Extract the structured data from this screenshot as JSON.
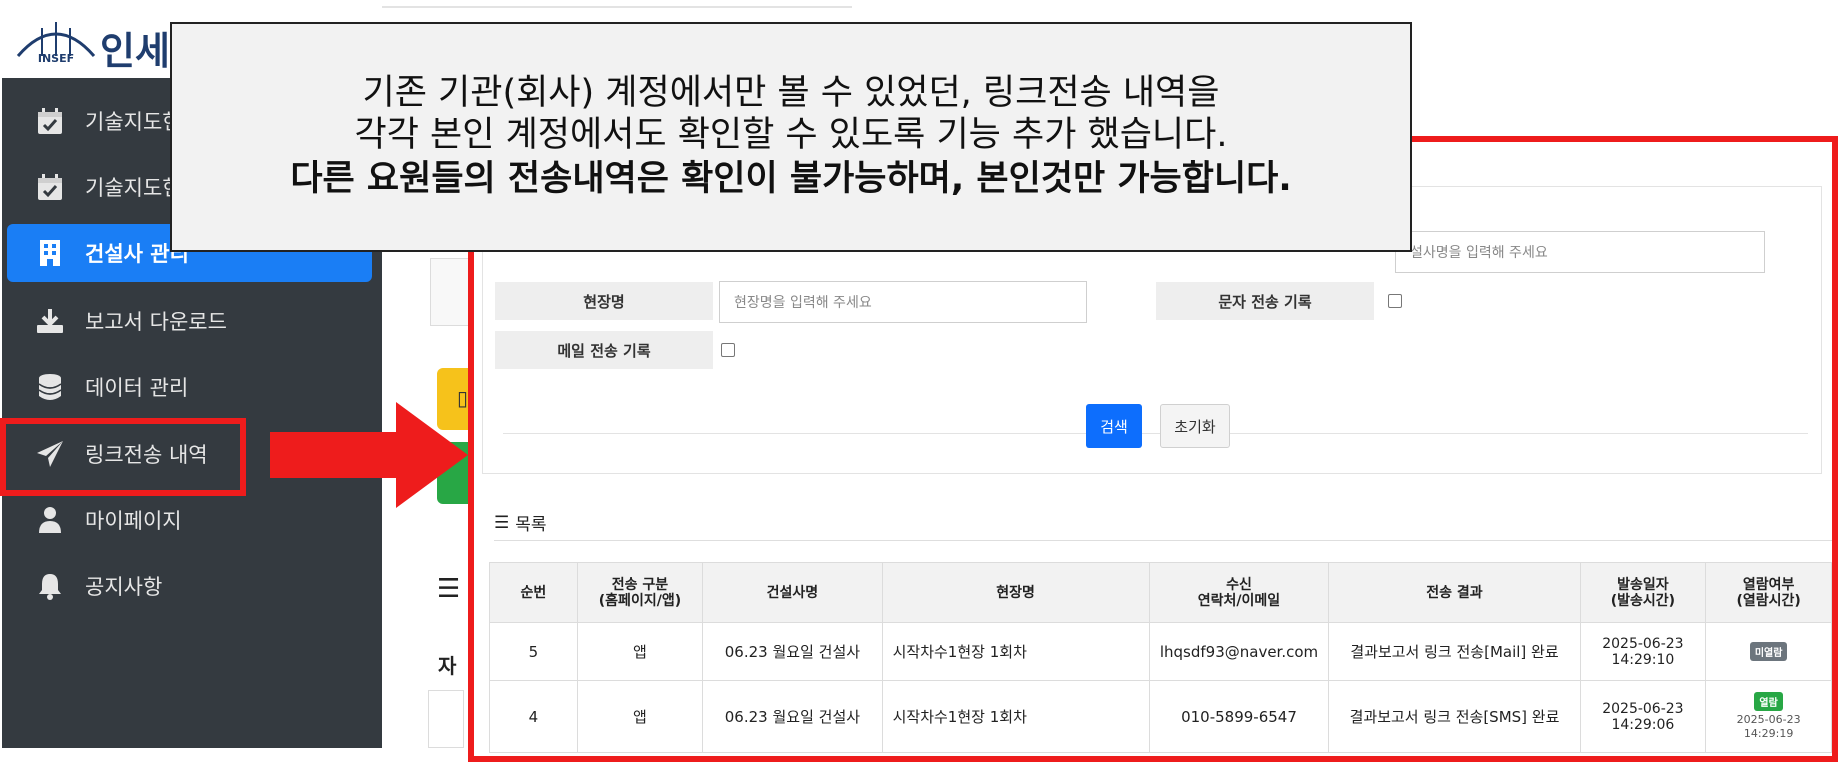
{
  "logo": {
    "mark_text": "INSEF",
    "title": "인세"
  },
  "sidebar": {
    "items": [
      {
        "label": "기술지도현",
        "icon": "calendar-check-icon"
      },
      {
        "label": "기술지도현",
        "icon": "calendar-check-icon"
      },
      {
        "label": "건설사 관리",
        "icon": "building-icon",
        "active": true
      },
      {
        "label": "보고서 다운로드",
        "icon": "download-icon"
      },
      {
        "label": "데이터 관리",
        "icon": "database-icon"
      },
      {
        "label": "링크전송 내역",
        "icon": "paper-plane-icon",
        "highlighted": true
      },
      {
        "label": "마이페이지",
        "icon": "user-icon"
      },
      {
        "label": "공지사항",
        "icon": "bell-icon"
      }
    ]
  },
  "callout": {
    "line1": "기존 기관(회사) 계정에서만 볼 수 있었던, 링크전송 내역을",
    "line2": "각각 본인 계정에서도 확인할 수 있도록 기능 추가 했습니다.",
    "line3": "다른 요원들의 전송내역은 확인이 불가능하며, 본인것만 가능합니다."
  },
  "search": {
    "company_placeholder": "설사명을 입력해 주세요",
    "site_label": "현장명",
    "site_placeholder": "현장명을 입력해 주세요",
    "sms_label": "문자 전송 기록",
    "mail_label": "메일 전송 기록",
    "search_button": "검색",
    "reset_button": "초기화"
  },
  "list": {
    "title": "목록",
    "headers": [
      "순번",
      "전송 구분\n(홈페이지/앱)",
      "건설사명",
      "현장명",
      "수신\n연락처/이메일",
      "전송 결과",
      "발송일자\n(발송시간)",
      "열람여부\n(열람시간)"
    ],
    "rows": [
      {
        "no": "5",
        "type": "앱",
        "company": "06.23 월요일 건설사",
        "site": "시작차수1현장 1회차",
        "recipient": "lhqsdf93@naver.com",
        "result": "결과보고서 링크 전송[Mail] 완료",
        "sent_date": "2025-06-23",
        "sent_time": "14:29:10",
        "read_badge": "미열람",
        "read_time": ""
      },
      {
        "no": "4",
        "type": "앱",
        "company": "06.23 월요일 건설사",
        "site": "시작차수1현장 1회차",
        "recipient": "010-5899-6547",
        "result": "결과보고서 링크 전송[SMS] 완료",
        "sent_date": "2025-06-23",
        "sent_time": "14:29:06",
        "read_badge": "열람",
        "read_time": "2025-06-23\n14:29:19"
      }
    ]
  },
  "colors": {
    "highlight_red": "#ee1c1c",
    "sidebar_bg": "#343a40",
    "active_blue": "#1a7ef5"
  }
}
